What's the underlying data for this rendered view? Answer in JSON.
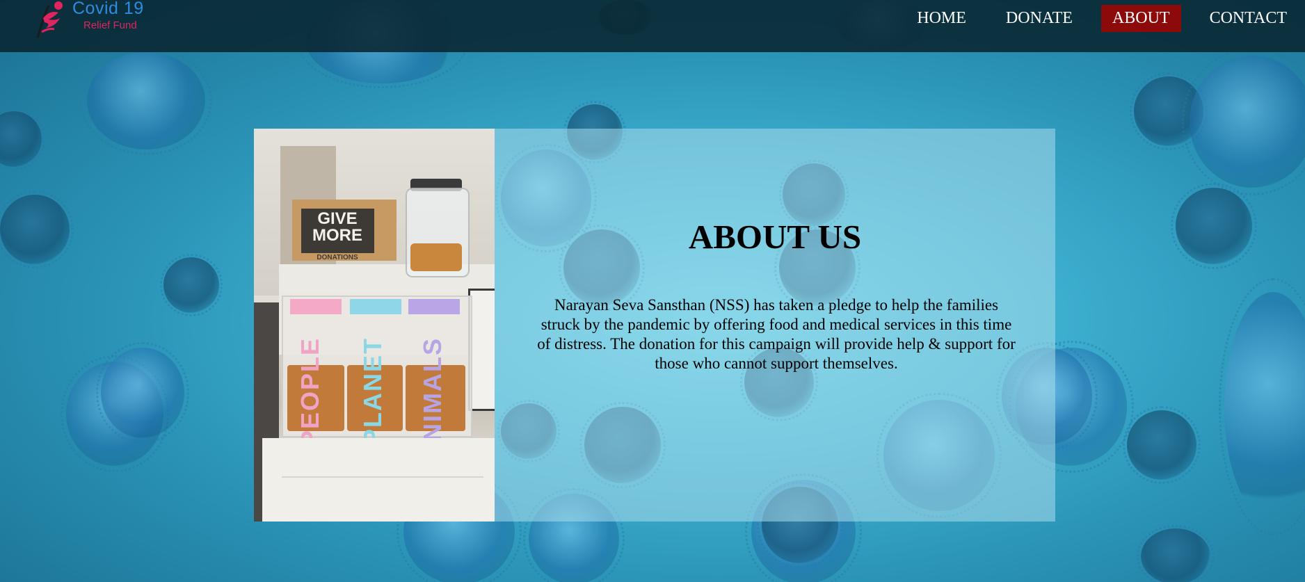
{
  "logo": {
    "title": "Covid 19",
    "subtitle": "Relief Fund",
    "icon": "running-figure-logo-icon"
  },
  "nav": {
    "items": [
      {
        "label": "HOME",
        "active": false
      },
      {
        "label": "DONATE",
        "active": false
      },
      {
        "label": "ABOUT",
        "active": true
      },
      {
        "label": "CONTACT",
        "active": false
      }
    ]
  },
  "about": {
    "title": "ABOUT US",
    "body": "Narayan Seva Sansthan (NSS) has taken a pledge to help the families struck by the pandemic by offering food and medical services in this time of distress. The donation for this campaign will provide help & support for those who cannot support themselves."
  },
  "photo": {
    "sign_text": "GIVE MORE",
    "sign_small": "DONATIONS",
    "box_labels": [
      "PEOPLE",
      "PLANET",
      "ANIMALS"
    ]
  },
  "colors": {
    "header_bg": "#092630",
    "nav_active_bg": "#8c0a0a",
    "logo_blue": "#2f8be0",
    "logo_pink": "#e0245e",
    "panel_bg": "#aadceb"
  }
}
